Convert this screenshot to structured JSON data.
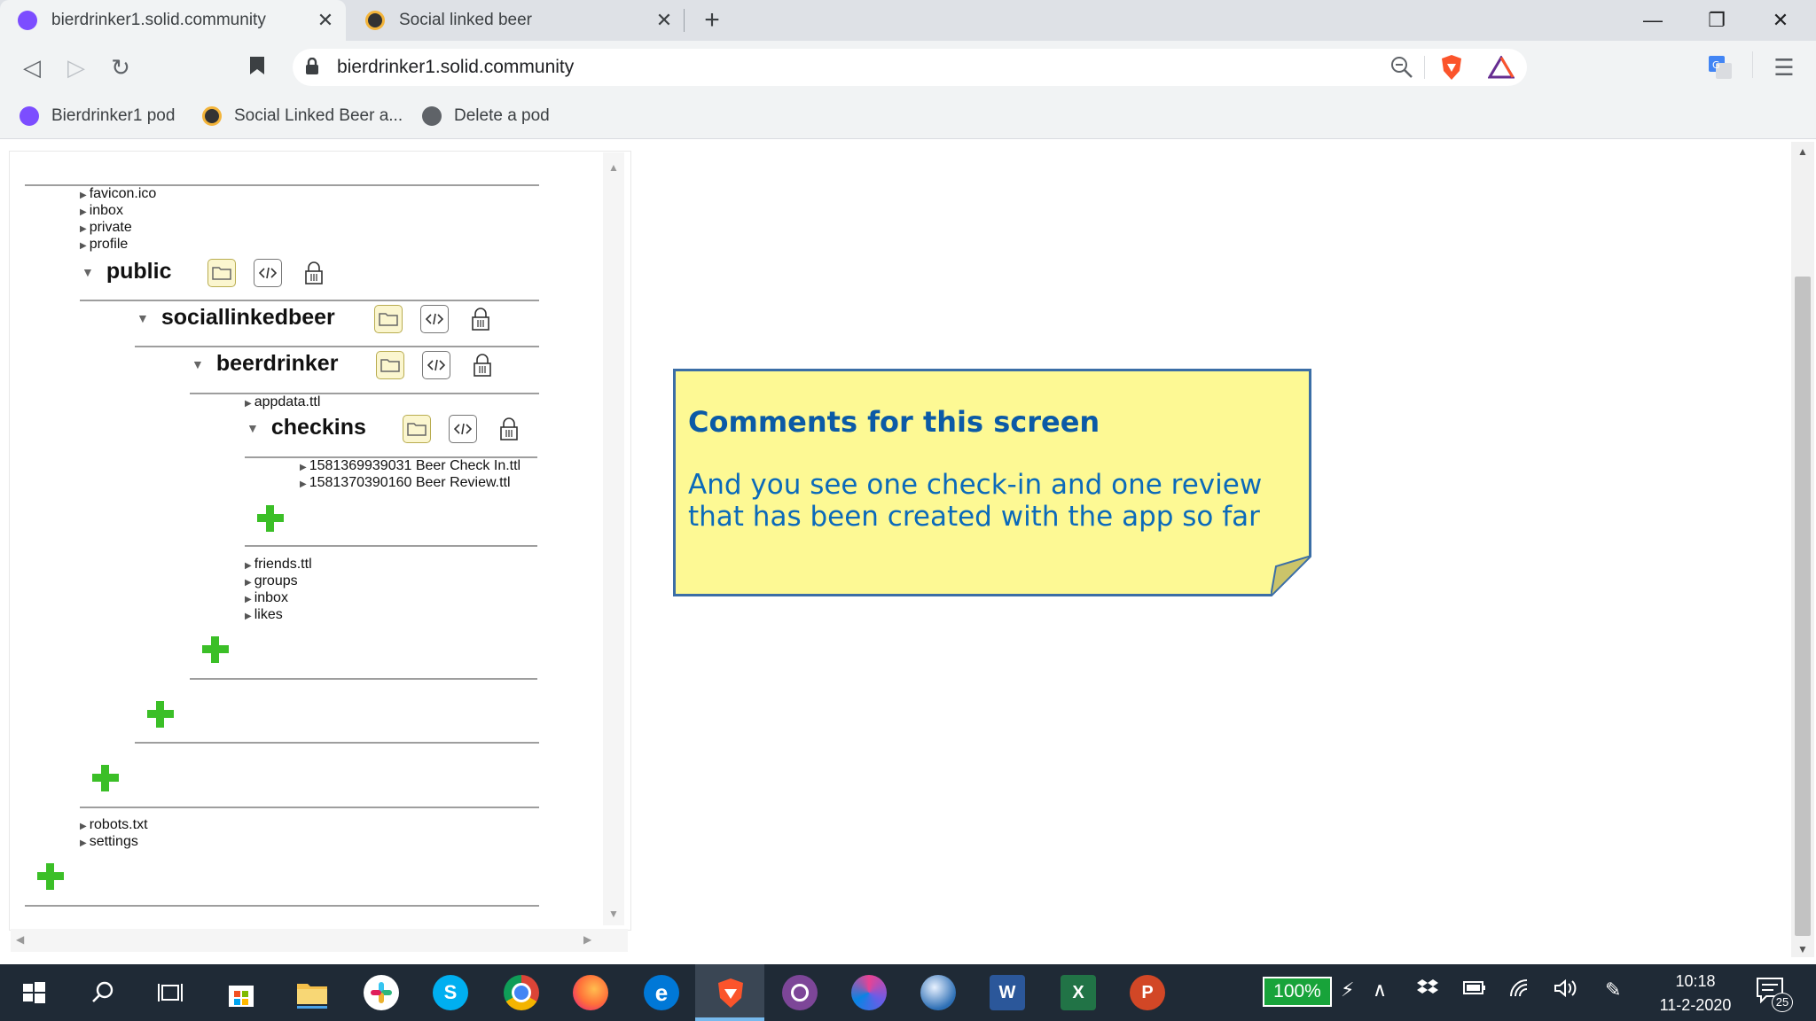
{
  "browser": {
    "tabs": [
      {
        "title": "bierdrinker1.solid.community",
        "active": true
      },
      {
        "title": "Social linked beer",
        "active": false
      }
    ],
    "new_tab_glyph": "+",
    "window_controls": {
      "minimize": "—",
      "restore": "❐",
      "close": "✕"
    },
    "url": "bierdrinker1.solid.community",
    "bookmarks": [
      {
        "label": "Bierdrinker1 pod"
      },
      {
        "label": "Social Linked Beer a..."
      },
      {
        "label": "Delete a pod"
      }
    ],
    "nav": {
      "back": "◁",
      "forward": "▷",
      "reload": "↻",
      "menu": "☰"
    }
  },
  "explorer": {
    "root_items_top": [
      "favicon.ico",
      "inbox",
      "private",
      "profile"
    ],
    "public": {
      "name": "public"
    },
    "sociallinkedbeer": {
      "name": "sociallinkedbeer"
    },
    "beerdrinker": {
      "name": "beerdrinker"
    },
    "beerdrinker_items_top": [
      "appdata.ttl"
    ],
    "checkins": {
      "name": "checkins",
      "files": [
        "1581369939031 Beer Check In.ttl",
        "1581370390160 Beer Review.ttl"
      ]
    },
    "beerdrinker_items_bottom": [
      "friends.ttl",
      "groups",
      "inbox",
      "likes"
    ],
    "root_items_bottom": [
      "robots.txt",
      "settings"
    ]
  },
  "note": {
    "title": "Comments for this screen",
    "body": "And you see one check-in and one review that has been created with the app so far"
  },
  "taskbar": {
    "battery": "100%",
    "time": "10:18",
    "date": "11-2-2020",
    "notifications": "25",
    "apps": [
      "windows-start",
      "search",
      "task-view",
      "store",
      "file-explorer",
      "slack",
      "skype",
      "chrome",
      "firefox",
      "edge",
      "brave",
      "tor",
      "app-swirl",
      "app-globe",
      "word",
      "excel",
      "powerpoint"
    ]
  },
  "colors": {
    "note_bg": "#fdf994",
    "note_border": "#3b6ea6",
    "note_text": "#0b5aa6",
    "plus_green": "#3bbf27",
    "taskbar_bg": "#1f2a36"
  }
}
